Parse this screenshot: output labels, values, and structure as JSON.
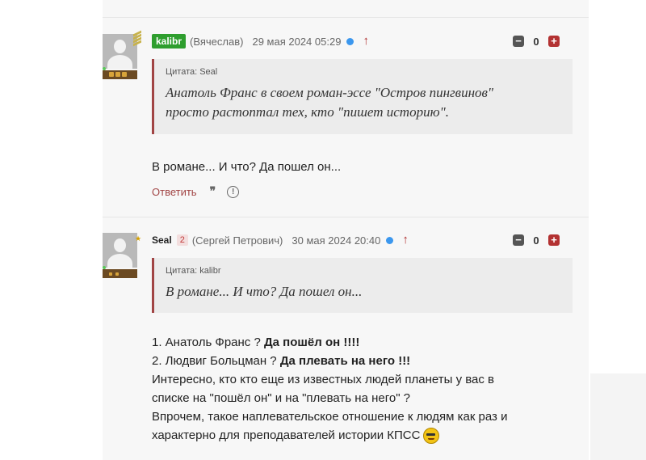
{
  "comments": [
    {
      "username": "kalibr",
      "realname": "(Вячеслав)",
      "date": "29 мая 2024 05:29",
      "votes": "0",
      "quote_label": "Цитата: Seal",
      "quote_text_1": "Анатоль Франс в своем роман-эссе \"Остров пингвинов\"",
      "quote_text_2": "просто растоптал тех, кто \"пишет историю\".",
      "body": "В романе... И что? Да пошел он...",
      "reply_label": "Ответить",
      "quote_icon": "quote-icon",
      "report_icon": "report-icon"
    },
    {
      "username": "Seal",
      "badge_count": "2",
      "realname": "(Сергей Петрович)",
      "date": "30 мая 2024 20:40",
      "votes": "0",
      "quote_label": "Цитата: kalibr",
      "quote_text": "В романе... И что? Да пошел он...",
      "lines": [
        {
          "text": "1. Анатоль Франс ? ",
          "bold": "Да пошёл он !!!!"
        },
        {
          "text": "2. Людвиг Больцман ? ",
          "bold": "Да плевать на него !!!"
        },
        {
          "text": "Интересно, кто кто еще из известных людей планеты у вас в"
        },
        {
          "text": "списке на \"пошёл он\" и на \"плевать на него\" ?"
        },
        {
          "text": "Впрочем, такое наплевательское отношение к людям как раз и"
        },
        {
          "text": "характерно для преподавателей истории КПСС"
        }
      ]
    }
  ],
  "vote_minus": "−",
  "vote_plus": "+",
  "arrow_up": "↑",
  "quote_glyph": "❞",
  "report_glyph": "!"
}
